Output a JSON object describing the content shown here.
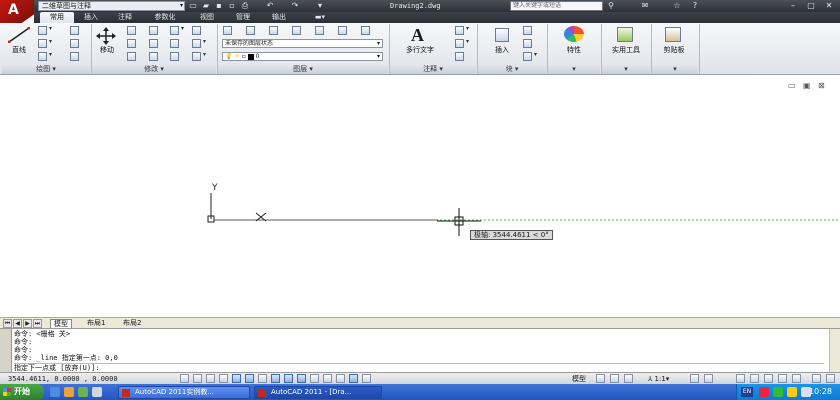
{
  "titlebar": {
    "workspace": "二维草图与注释",
    "doc_title": "Drawing2.dwg",
    "search_placeholder": "键入关键字或短语"
  },
  "ribbon_tabs": [
    "常用",
    "插入",
    "注释",
    "参数化",
    "视图",
    "管理",
    "输出"
  ],
  "panels": {
    "draw": {
      "label": "绘图",
      "line": "直线"
    },
    "modify": {
      "label": "修改",
      "move": "移动"
    },
    "layers": {
      "label": "图层",
      "state": "未保存的图层状态",
      "current_layer": "0"
    },
    "annotation": {
      "label": "注释",
      "mtext": "多行文字"
    },
    "block": {
      "label": "块",
      "insert": "插入"
    },
    "properties": {
      "label": "特性"
    },
    "utilities": {
      "label": "实用工具"
    },
    "clipboard": {
      "label": "剪贴板"
    }
  },
  "canvas": {
    "ucs_y": "Y",
    "tooltip": "极轴: 3544.4611 < 0°"
  },
  "layout_tabs": [
    "模型",
    "布局1",
    "布局2"
  ],
  "command": {
    "lines": [
      "命令: <栅格 关>",
      "命令:",
      "命令:",
      "命令: _line 指定第一点: 0,0"
    ],
    "prompt": "指定下一点或 [放弃(U)]:"
  },
  "status": {
    "coords": "3544.4611, 0.0000  , 0.0000",
    "model": "模型",
    "scale": "1:1"
  },
  "taskbar": {
    "start": "开始",
    "tasks": [
      "AutoCAD 2011实例教...",
      "AutoCAD 2011 - [Dra..."
    ],
    "lang": "EN",
    "clock": "10:28"
  },
  "colors": {
    "autocad_red": "#c21a12",
    "titlebar": "#2d3037",
    "taskbar": "#2456c0",
    "polar_track": "#3fbf3f"
  }
}
